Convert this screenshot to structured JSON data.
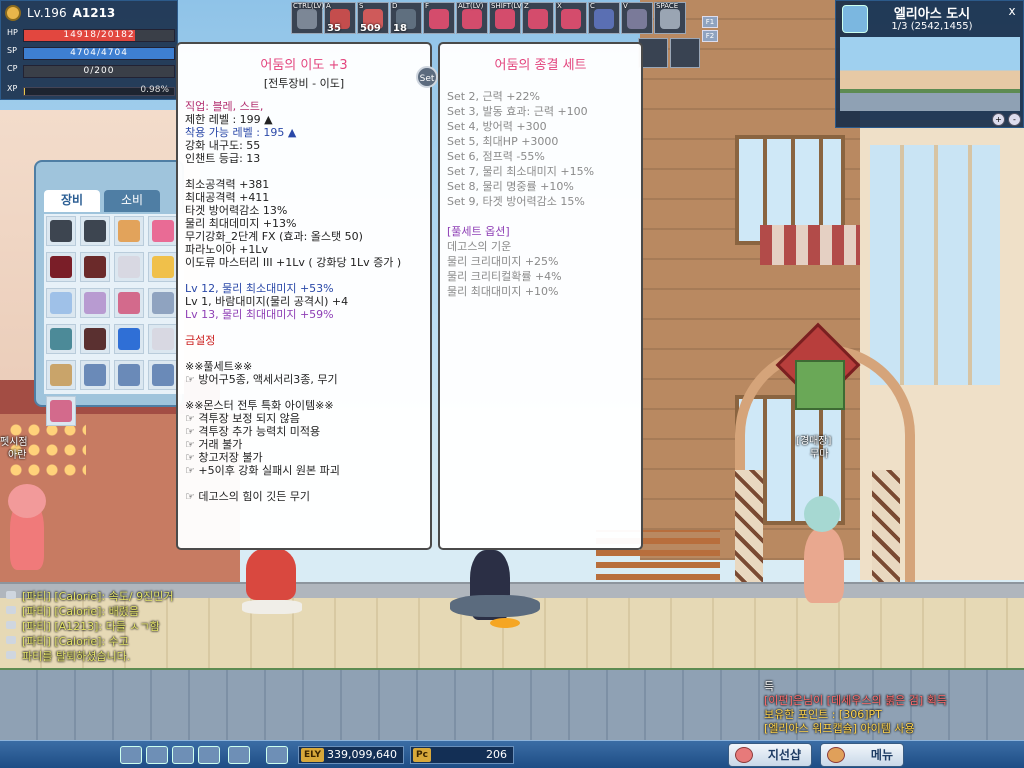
{
  "status": {
    "level_label": "Lv.196",
    "name": "A1213",
    "hp": {
      "label": "HP",
      "text": "14918/20182",
      "ratio": 0.739
    },
    "sp": {
      "label": "SP",
      "text": "4704/4704",
      "ratio": 1.0
    },
    "cp": {
      "label": "CP",
      "text": "0/200",
      "ratio": 0.0
    },
    "xp": {
      "label": "XP",
      "text": "0.98%",
      "ratio": 0.0098
    },
    "colors": {
      "hp": "#e2473f",
      "sp": "#3e7fd1",
      "cp": "#6aa8d8"
    }
  },
  "skillbar": {
    "slots": [
      {
        "key": "CTRL(LV)",
        "count": "",
        "color": "#7c8796"
      },
      {
        "key": "A",
        "count": "35",
        "color": "#c44d4d"
      },
      {
        "key": "S",
        "count": "509",
        "color": "#cf5a5a"
      },
      {
        "key": "D",
        "count": "18",
        "color": "#5f6f7f"
      },
      {
        "key": "F",
        "count": "",
        "color": "#d44c6c"
      },
      {
        "key": "ALT(LV)",
        "count": "",
        "color": "#d44c6c"
      },
      {
        "key": "SHIFT(LV)",
        "count": "",
        "color": "#d44c6c"
      },
      {
        "key": "Z",
        "count": "",
        "color": "#d44c6c"
      },
      {
        "key": "X",
        "count": "",
        "color": "#d44c6c"
      },
      {
        "key": "C",
        "count": "",
        "color": "#5a6fb3"
      },
      {
        "key": "V",
        "count": "",
        "color": "#7a7a99"
      },
      {
        "key": "SPACE",
        "count": "",
        "color": "#9aa5b3"
      }
    ],
    "f_keys": [
      "F1",
      "F2"
    ]
  },
  "minimap": {
    "title": "엘리아스 도시",
    "coords": "1/3 (2542,1455)",
    "close": "x"
  },
  "inventory": {
    "tabs": [
      "장비",
      "소비"
    ],
    "active_tab": "장비",
    "item_colors": [
      "#3d4550",
      "#3d4550",
      "#e2a35b",
      "#e96b95",
      "#7a1e28",
      "#6b2a2a",
      "#d8d8e2",
      "#f0c04a",
      "#9fc1e8",
      "#b89bd1",
      "#d36a8c",
      "#8fa3c0",
      "#4c8a98",
      "#5a3030",
      "#2f6fd6",
      "#d8d8e2",
      "#c9a46a",
      "#6a8ab8",
      "#6a8ab8",
      "#6a8ab8",
      "#d36a8c"
    ]
  },
  "tooltip_item": {
    "title": "어둠의 이도 +3",
    "subtitle": "[전투장비 - 이도]",
    "lines": [
      {
        "text": "직업: 블레, 스트,",
        "style": "pink"
      },
      {
        "text": "제한 레벨 : 199 ▲",
        "style": "normal"
      },
      {
        "text": "착용 가능 레벨 : 195 ▲",
        "style": "blue"
      },
      {
        "text": "강화 내구도: 55",
        "style": "normal"
      },
      {
        "text": "인챈트 등급: 13",
        "style": "normal"
      },
      {
        "text": "",
        "style": "normal"
      },
      {
        "text": "최소공격력 +381",
        "style": "normal"
      },
      {
        "text": "최대공격력 +411",
        "style": "normal"
      },
      {
        "text": "타겟 방어력감소 13%",
        "style": "normal"
      },
      {
        "text": "물리 최대데미지 +13%",
        "style": "normal"
      },
      {
        "text": "무기강화_2단계 FX (효과: 올스탯 50)",
        "style": "normal"
      },
      {
        "text": "파라노이아 +1Lv",
        "style": "normal"
      },
      {
        "text": "이도류 마스터리 III +1Lv ( 강화당 1Lv 증가 )",
        "style": "normal"
      },
      {
        "text": "",
        "style": "normal"
      },
      {
        "text": "Lv 12, 물리 최소대미지 +53%",
        "style": "blue"
      },
      {
        "text": "Lv 1, 바람대미지(물리 공격시) +4",
        "style": "normal"
      },
      {
        "text": "Lv 13, 물리 최대대미지 +59%",
        "style": "purple"
      },
      {
        "text": "",
        "style": "normal"
      },
      {
        "text": "금설정",
        "style": "red"
      },
      {
        "text": "",
        "style": "normal"
      },
      {
        "text": "※※풀세트※※",
        "style": "normal"
      },
      {
        "text": "☞ 방어구5종, 액세서리3종, 무기",
        "style": "normal"
      },
      {
        "text": "",
        "style": "normal"
      },
      {
        "text": "※※몬스터 전투 특화 아이템※※",
        "style": "normal"
      },
      {
        "text": "☞ 격투장 보정 되지 않음",
        "style": "normal"
      },
      {
        "text": "☞ 격투장 추가 능력치 미적용",
        "style": "normal"
      },
      {
        "text": "☞ 거래 불가",
        "style": "normal"
      },
      {
        "text": "☞ 창고저장 불가",
        "style": "normal"
      },
      {
        "text": "☞ +5이후 강화 실패시 원본 파괴",
        "style": "normal"
      },
      {
        "text": "",
        "style": "normal"
      },
      {
        "text": "☞ 데고스의 힘이 깃든 무기",
        "style": "normal"
      }
    ],
    "set_badge": "Set"
  },
  "tooltip_set": {
    "title": "어둠의 종결 세트",
    "lines": [
      {
        "text": "Set 2, 근력 +22%",
        "style": "grey"
      },
      {
        "text": "Set 3, 발동 효과: 근력 +100",
        "style": "grey"
      },
      {
        "text": "Set 4, 방어력 +300",
        "style": "grey"
      },
      {
        "text": "Set 5, 최대HP +3000",
        "style": "grey"
      },
      {
        "text": "Set 6, 점프력 -55%",
        "style": "grey"
      },
      {
        "text": "Set 7, 물리 최소대미지 +15%",
        "style": "grey"
      },
      {
        "text": "Set 8, 물리 명중률 +10%",
        "style": "grey"
      },
      {
        "text": "Set 9, 타겟 방어력감소 15%",
        "style": "grey"
      },
      {
        "text": "",
        "style": "grey"
      },
      {
        "text": "[풀세트 옵션]",
        "style": "purple"
      },
      {
        "text": " 데고스의 기운",
        "style": "grey"
      },
      {
        "text": " 물리 크리대미지 +25%",
        "style": "grey"
      },
      {
        "text": " 물리 크리티컬확률 +4%",
        "style": "grey"
      },
      {
        "text": " 물리 최대대미지 +10%",
        "style": "grey"
      }
    ]
  },
  "npcs": {
    "left_tag": "펫시점",
    "left_name": "아란",
    "right_tag": "[경매장]",
    "right_name": "무마"
  },
  "chat": {
    "lines": [
      "[파티] [Calorie]: 속도/ 9진민거",
      "[파티] [Calorie]: 배렸음",
      "[파티] [A1213]: 다들 ㅅㄱ함",
      "[파티] [Calorie]: 수고",
      "파티를 탈퇴하셨습니다."
    ]
  },
  "system_messages": {
    "lines": [
      {
        "text": "득",
        "color": "#ffffff"
      },
      {
        "text": "[이펀]은님이 [데세우스의 붉은 검] 획득",
        "color": "#ff6b6b"
      },
      {
        "text": "보유한 포인트 : [306]PT",
        "color": "#ffd34a"
      },
      {
        "text": "[엘리아스 워프캡슐] 아이템 사용",
        "color": "#ffd34a"
      }
    ]
  },
  "bottom": {
    "ely_tag": "ELY",
    "ely_value": "339,099,640",
    "pc_tag": "Pc",
    "pc_value": "206",
    "shop_button": "지선샵",
    "menu_button": "메뉴"
  }
}
